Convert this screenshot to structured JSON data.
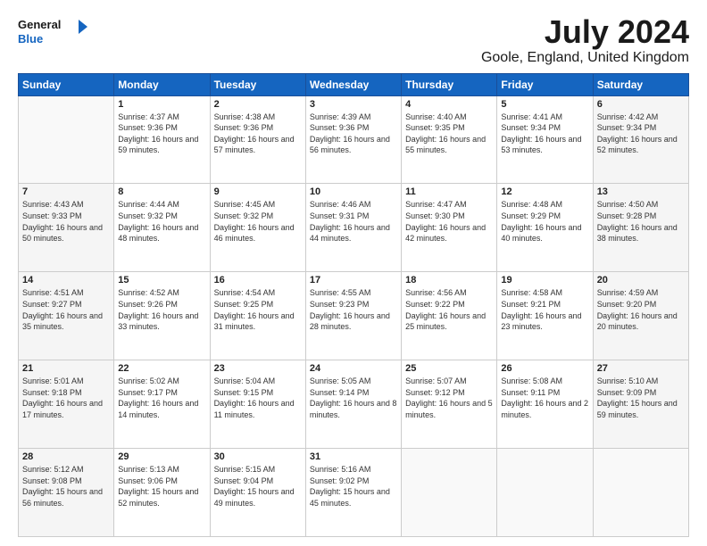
{
  "logo": {
    "line1": "General",
    "line2": "Blue"
  },
  "title": "July 2024",
  "subtitle": "Goole, England, United Kingdom",
  "days_header": [
    "Sunday",
    "Monday",
    "Tuesday",
    "Wednesday",
    "Thursday",
    "Friday",
    "Saturday"
  ],
  "weeks": [
    [
      {
        "day": "",
        "sunrise": "",
        "sunset": "",
        "daylight": ""
      },
      {
        "day": "1",
        "sunrise": "Sunrise: 4:37 AM",
        "sunset": "Sunset: 9:36 PM",
        "daylight": "Daylight: 16 hours and 59 minutes."
      },
      {
        "day": "2",
        "sunrise": "Sunrise: 4:38 AM",
        "sunset": "Sunset: 9:36 PM",
        "daylight": "Daylight: 16 hours and 57 minutes."
      },
      {
        "day": "3",
        "sunrise": "Sunrise: 4:39 AM",
        "sunset": "Sunset: 9:36 PM",
        "daylight": "Daylight: 16 hours and 56 minutes."
      },
      {
        "day": "4",
        "sunrise": "Sunrise: 4:40 AM",
        "sunset": "Sunset: 9:35 PM",
        "daylight": "Daylight: 16 hours and 55 minutes."
      },
      {
        "day": "5",
        "sunrise": "Sunrise: 4:41 AM",
        "sunset": "Sunset: 9:34 PM",
        "daylight": "Daylight: 16 hours and 53 minutes."
      },
      {
        "day": "6",
        "sunrise": "Sunrise: 4:42 AM",
        "sunset": "Sunset: 9:34 PM",
        "daylight": "Daylight: 16 hours and 52 minutes."
      }
    ],
    [
      {
        "day": "7",
        "sunrise": "Sunrise: 4:43 AM",
        "sunset": "Sunset: 9:33 PM",
        "daylight": "Daylight: 16 hours and 50 minutes."
      },
      {
        "day": "8",
        "sunrise": "Sunrise: 4:44 AM",
        "sunset": "Sunset: 9:32 PM",
        "daylight": "Daylight: 16 hours and 48 minutes."
      },
      {
        "day": "9",
        "sunrise": "Sunrise: 4:45 AM",
        "sunset": "Sunset: 9:32 PM",
        "daylight": "Daylight: 16 hours and 46 minutes."
      },
      {
        "day": "10",
        "sunrise": "Sunrise: 4:46 AM",
        "sunset": "Sunset: 9:31 PM",
        "daylight": "Daylight: 16 hours and 44 minutes."
      },
      {
        "day": "11",
        "sunrise": "Sunrise: 4:47 AM",
        "sunset": "Sunset: 9:30 PM",
        "daylight": "Daylight: 16 hours and 42 minutes."
      },
      {
        "day": "12",
        "sunrise": "Sunrise: 4:48 AM",
        "sunset": "Sunset: 9:29 PM",
        "daylight": "Daylight: 16 hours and 40 minutes."
      },
      {
        "day": "13",
        "sunrise": "Sunrise: 4:50 AM",
        "sunset": "Sunset: 9:28 PM",
        "daylight": "Daylight: 16 hours and 38 minutes."
      }
    ],
    [
      {
        "day": "14",
        "sunrise": "Sunrise: 4:51 AM",
        "sunset": "Sunset: 9:27 PM",
        "daylight": "Daylight: 16 hours and 35 minutes."
      },
      {
        "day": "15",
        "sunrise": "Sunrise: 4:52 AM",
        "sunset": "Sunset: 9:26 PM",
        "daylight": "Daylight: 16 hours and 33 minutes."
      },
      {
        "day": "16",
        "sunrise": "Sunrise: 4:54 AM",
        "sunset": "Sunset: 9:25 PM",
        "daylight": "Daylight: 16 hours and 31 minutes."
      },
      {
        "day": "17",
        "sunrise": "Sunrise: 4:55 AM",
        "sunset": "Sunset: 9:23 PM",
        "daylight": "Daylight: 16 hours and 28 minutes."
      },
      {
        "day": "18",
        "sunrise": "Sunrise: 4:56 AM",
        "sunset": "Sunset: 9:22 PM",
        "daylight": "Daylight: 16 hours and 25 minutes."
      },
      {
        "day": "19",
        "sunrise": "Sunrise: 4:58 AM",
        "sunset": "Sunset: 9:21 PM",
        "daylight": "Daylight: 16 hours and 23 minutes."
      },
      {
        "day": "20",
        "sunrise": "Sunrise: 4:59 AM",
        "sunset": "Sunset: 9:20 PM",
        "daylight": "Daylight: 16 hours and 20 minutes."
      }
    ],
    [
      {
        "day": "21",
        "sunrise": "Sunrise: 5:01 AM",
        "sunset": "Sunset: 9:18 PM",
        "daylight": "Daylight: 16 hours and 17 minutes."
      },
      {
        "day": "22",
        "sunrise": "Sunrise: 5:02 AM",
        "sunset": "Sunset: 9:17 PM",
        "daylight": "Daylight: 16 hours and 14 minutes."
      },
      {
        "day": "23",
        "sunrise": "Sunrise: 5:04 AM",
        "sunset": "Sunset: 9:15 PM",
        "daylight": "Daylight: 16 hours and 11 minutes."
      },
      {
        "day": "24",
        "sunrise": "Sunrise: 5:05 AM",
        "sunset": "Sunset: 9:14 PM",
        "daylight": "Daylight: 16 hours and 8 minutes."
      },
      {
        "day": "25",
        "sunrise": "Sunrise: 5:07 AM",
        "sunset": "Sunset: 9:12 PM",
        "daylight": "Daylight: 16 hours and 5 minutes."
      },
      {
        "day": "26",
        "sunrise": "Sunrise: 5:08 AM",
        "sunset": "Sunset: 9:11 PM",
        "daylight": "Daylight: 16 hours and 2 minutes."
      },
      {
        "day": "27",
        "sunrise": "Sunrise: 5:10 AM",
        "sunset": "Sunset: 9:09 PM",
        "daylight": "Daylight: 15 hours and 59 minutes."
      }
    ],
    [
      {
        "day": "28",
        "sunrise": "Sunrise: 5:12 AM",
        "sunset": "Sunset: 9:08 PM",
        "daylight": "Daylight: 15 hours and 56 minutes."
      },
      {
        "day": "29",
        "sunrise": "Sunrise: 5:13 AM",
        "sunset": "Sunset: 9:06 PM",
        "daylight": "Daylight: 15 hours and 52 minutes."
      },
      {
        "day": "30",
        "sunrise": "Sunrise: 5:15 AM",
        "sunset": "Sunset: 9:04 PM",
        "daylight": "Daylight: 15 hours and 49 minutes."
      },
      {
        "day": "31",
        "sunrise": "Sunrise: 5:16 AM",
        "sunset": "Sunset: 9:02 PM",
        "daylight": "Daylight: 15 hours and 45 minutes."
      },
      {
        "day": "",
        "sunrise": "",
        "sunset": "",
        "daylight": ""
      },
      {
        "day": "",
        "sunrise": "",
        "sunset": "",
        "daylight": ""
      },
      {
        "day": "",
        "sunrise": "",
        "sunset": "",
        "daylight": ""
      }
    ]
  ]
}
